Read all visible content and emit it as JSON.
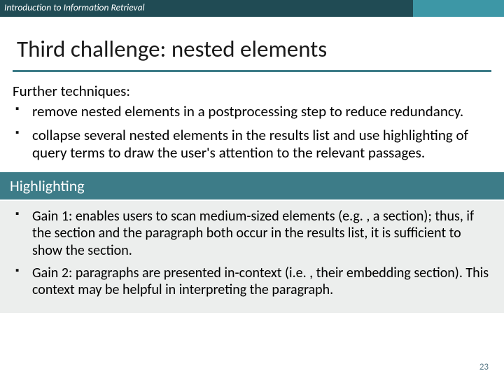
{
  "topbar": {
    "label": "Introduction to Information Retrieval"
  },
  "title": "Third challenge: nested elements",
  "lead": "Further techniques:",
  "bullets": [
    "remove nested elements in a postprocessing step to reduce redundancy.",
    "collapse several nested elements in the results list and use highlighting of query terms to draw the user's attention to the relevant passages."
  ],
  "section_bar": "Highlighting",
  "box_bullets": [
    "Gain 1: enables users to scan medium-sized elements (e.g. , a section); thus, if the section and the paragraph both occur in the results list, it is sufficient to show the section.",
    "Gain 2: paragraphs are presented in-context (i.e. , their embedding section). This context may be helpful in interpreting the paragraph."
  ],
  "page_number": "23"
}
